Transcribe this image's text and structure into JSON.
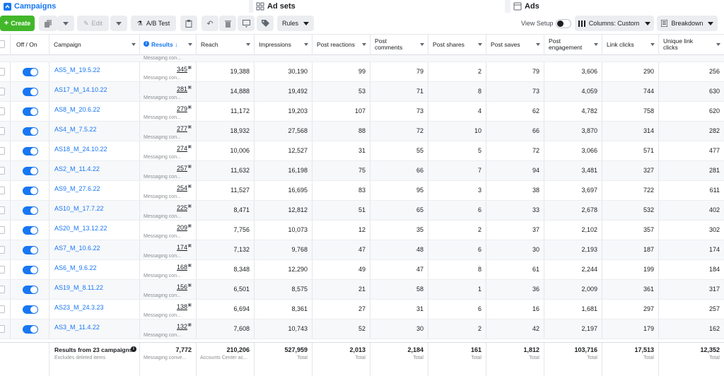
{
  "tabs": [
    {
      "label": "Campaigns",
      "icon": "grid-icon"
    },
    {
      "label": "Ad sets",
      "icon": "adsets-icon"
    },
    {
      "label": "Ads",
      "icon": "ads-icon"
    }
  ],
  "toolbar": {
    "create_label": "Create",
    "edit_label": "Edit",
    "abtest_label": "A/B Test",
    "rules_label": "Rules",
    "view_setup_label": "View Setup",
    "columns_label": "Columns: Custom",
    "breakdown_label": "Breakdown"
  },
  "columns": [
    {
      "label": "Off / On"
    },
    {
      "label": "Campaign"
    },
    {
      "label": "Results ↓"
    },
    {
      "label": "Reach"
    },
    {
      "label": "Impressions"
    },
    {
      "label": "Post reactions"
    },
    {
      "label": "Post comments"
    },
    {
      "label": "Post shares"
    },
    {
      "label": "Post saves"
    },
    {
      "label": "Post engagement"
    },
    {
      "label": "Link clicks"
    },
    {
      "label": "Unique link clicks"
    }
  ],
  "rows": [
    {
      "name": "AS5_M_19.5.22",
      "results": "345",
      "results_sub": "Messaging con...",
      "vals": [
        "19,388",
        "30,190",
        "99",
        "79",
        "2",
        "79",
        "3,606",
        "290",
        "256"
      ]
    },
    {
      "name": "AS17_M_14.10.22",
      "results": "281",
      "results_sub": "Messaging con...",
      "vals": [
        "14,888",
        "19,492",
        "53",
        "71",
        "8",
        "73",
        "4,059",
        "744",
        "630"
      ]
    },
    {
      "name": "AS8_M_20.6.22",
      "results": "279",
      "results_sub": "Messaging con...",
      "vals": [
        "11,172",
        "19,203",
        "107",
        "73",
        "4",
        "62",
        "4,782",
        "758",
        "620"
      ]
    },
    {
      "name": "AS4_M_7.5.22",
      "results": "277",
      "results_sub": "Messaging con...",
      "vals": [
        "18,932",
        "27,568",
        "88",
        "72",
        "10",
        "66",
        "3,870",
        "314",
        "282"
      ]
    },
    {
      "name": "AS18_M_24.10.22",
      "results": "274",
      "results_sub": "Messaging con...",
      "vals": [
        "10,006",
        "12,527",
        "31",
        "55",
        "5",
        "72",
        "3,066",
        "571",
        "477"
      ]
    },
    {
      "name": "AS2_M_11.4.22",
      "results": "257",
      "results_sub": "Messaging con...",
      "vals": [
        "11,632",
        "16,198",
        "75",
        "66",
        "7",
        "94",
        "3,481",
        "327",
        "281"
      ]
    },
    {
      "name": "AS9_M_27.6.22",
      "results": "254",
      "results_sub": "Messaging con...",
      "vals": [
        "11,527",
        "16,695",
        "83",
        "95",
        "3",
        "38",
        "3,697",
        "722",
        "611"
      ]
    },
    {
      "name": "AS10_M_17.7.22",
      "results": "225",
      "results_sub": "Messaging con...",
      "vals": [
        "8,471",
        "12,812",
        "51",
        "65",
        "6",
        "33",
        "2,678",
        "532",
        "402"
      ]
    },
    {
      "name": "AS20_M_13.12.22",
      "results": "209",
      "results_sub": "Messaging con...",
      "vals": [
        "7,756",
        "10,073",
        "12",
        "35",
        "2",
        "37",
        "2,102",
        "357",
        "302"
      ]
    },
    {
      "name": "AS7_M_10.6.22",
      "results": "174",
      "results_sub": "Messaging con...",
      "vals": [
        "7,132",
        "9,768",
        "47",
        "48",
        "6",
        "30",
        "2,193",
        "187",
        "174"
      ]
    },
    {
      "name": "AS6_M_9.6.22",
      "results": "168",
      "results_sub": "Messaging con...",
      "vals": [
        "8,348",
        "12,290",
        "49",
        "47",
        "8",
        "61",
        "2,244",
        "199",
        "184"
      ]
    },
    {
      "name": "AS19_M_8.11.22",
      "results": "156",
      "results_sub": "Messaging con...",
      "vals": [
        "6,501",
        "8,575",
        "21",
        "58",
        "1",
        "36",
        "2,009",
        "361",
        "317"
      ]
    },
    {
      "name": "AS23_M_24.3.23",
      "results": "138",
      "results_sub": "Messaging con...",
      "vals": [
        "6,694",
        "8,361",
        "27",
        "31",
        "6",
        "16",
        "1,681",
        "297",
        "257"
      ]
    },
    {
      "name": "AS3_M_11.4.22",
      "results": "132",
      "results_sub": "Messaging con...",
      "vals": [
        "7,608",
        "10,743",
        "52",
        "30",
        "2",
        "42",
        "2,197",
        "179",
        "162"
      ]
    }
  ],
  "top_partial_sub": "Messaging con...",
  "footer": {
    "summary": "Results from 23 campaigns.",
    "summary_sub": "Excludes deleted items",
    "results": "7,772",
    "results_sub": "Messaging conve...",
    "reach": "210,206",
    "reach_sub": "Accounts Center ac...",
    "totals": [
      "527,959",
      "2,013",
      "2,184",
      "161",
      "1,812",
      "103,716",
      "17,513",
      "12,352"
    ],
    "total_label": "Total"
  },
  "colors": {
    "accent": "#1877f2",
    "create": "#42b72a"
  }
}
